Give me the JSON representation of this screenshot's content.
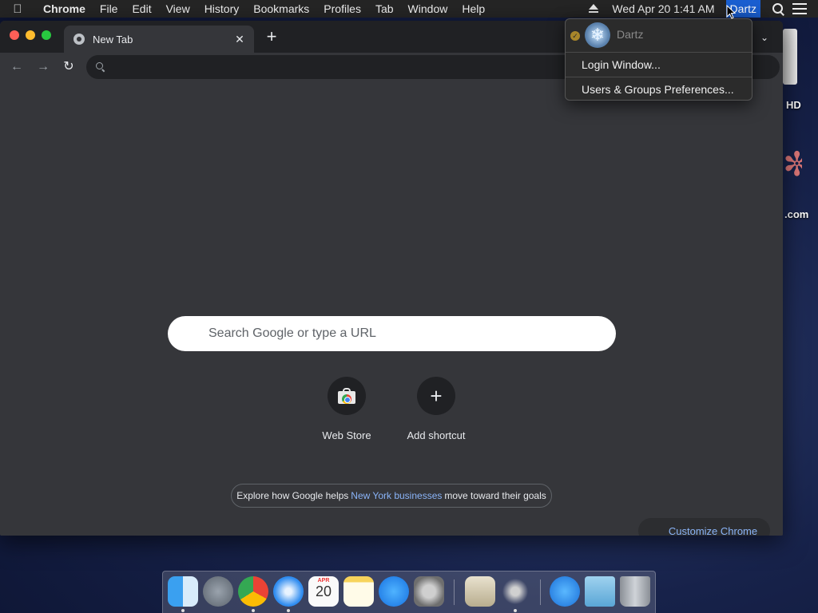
{
  "menubar": {
    "app_name": "Chrome",
    "items": [
      "File",
      "Edit",
      "View",
      "History",
      "Bookmarks",
      "Profiles",
      "Tab",
      "Window",
      "Help"
    ],
    "clock": "Wed Apr 20  1:41 AM",
    "user": "Dartz"
  },
  "desktop": {
    "hd_label": "HD",
    "com_label": ".com"
  },
  "chrome": {
    "tab_title": "New Tab",
    "tab_close": "✕",
    "new_tab": "+",
    "tab_overflow": "⌄",
    "back": "←",
    "forward": "→",
    "reload": "↻",
    "omnibox_value": ""
  },
  "ntp": {
    "search_placeholder": "Search Google or type a URL",
    "shortcuts": [
      {
        "label": "Web Store",
        "icon": "web-store-icon"
      },
      {
        "label": "Add shortcut",
        "icon": "plus-icon"
      }
    ],
    "promo": {
      "before": "Explore how Google helps",
      "link": "New York businesses",
      "after": "move toward their goals"
    },
    "customize_label": "Customize Chrome"
  },
  "user_menu": {
    "user_name": "Dartz",
    "items": [
      "Login Window...",
      "Users & Groups Preferences..."
    ]
  },
  "dock": {
    "calendar_month": "APR",
    "calendar_day": "20",
    "apps": [
      "finder-icon",
      "launchpad-icon",
      "chrome-icon",
      "safari-icon",
      "calendar-icon",
      "notes-icon",
      "app-store-icon",
      "system-preferences-icon",
      "archive-utility-icon",
      "utilities-icon",
      "applications-folder-icon",
      "documents-folder-icon",
      "trash-icon"
    ]
  }
}
